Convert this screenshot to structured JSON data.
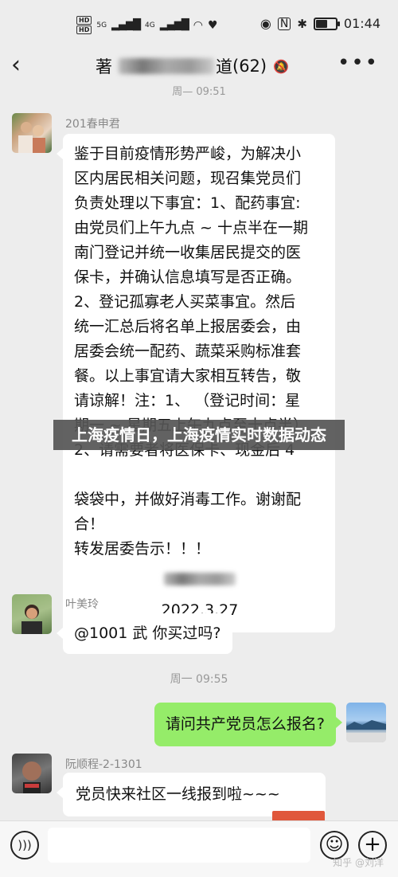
{
  "status_bar": {
    "hd1": "HD",
    "hd2": "HD",
    "signal1": "5G",
    "signal2": "4G",
    "time": "01:44"
  },
  "header": {
    "back_icon": "chevron-left-icon",
    "title_visible_suffix": "(62)",
    "title_prefix_char": "著",
    "title_partial_char": "道",
    "more_icon": "ellipsis-icon"
  },
  "time_header": "周— 09:51",
  "messages": [
    {
      "sender": "201春申君",
      "text": "鉴于目前疫情形势严峻，为解决小\n区内居民相关问题，现召集党员们\n负责处理以下事宜：1、配药事宜:\n由党员们上午九点 ~ 十点半在一期\n南门登记并统一收集居民提交的医\n保卡，并确认信息填写是否正确。\n2、登记孤寡老人买菜事宜。然后\n统一汇总后将名单上报居委会，由\n居委会统一配药、蔬菜采购标准套\n餐。以上事宜请大家相互转告，敬\n请谅解！注：1、 （登记时间：星\n期一 ~ 星期五上午九点至十点半）\n2、请需要者将医保卡、现金后 4\n\n袋袋中，并做好消毒工作。谢谢配\n合！\n转发居委告示！！！",
      "date": "2022.3.27",
      "avatar_icon": "person-photo-icon"
    },
    {
      "sender": "叶美玲",
      "text": "@1001 武  你买过吗?",
      "avatar_icon": "person-photo-icon"
    },
    {
      "sender": "阮顺程-2-1301",
      "text": "党员快来社区一线报到啦~~~",
      "avatar_icon": "person-photo-icon"
    }
  ],
  "time_separator": "周一 09:55",
  "my_message": {
    "text": "请问共产党员怎么报名?",
    "avatar_icon": "landscape-photo-icon"
  },
  "banner": "上海疫情日，上海疫情实时数据动态",
  "watermark": "知乎 @刘洋",
  "input": {
    "voice_icon": "voice-icon",
    "emoji_icon": "emoji-icon",
    "plus_icon": "plus-icon"
  },
  "colors": {
    "background": "#ededed",
    "my_bubble": "#95ec69",
    "other_bubble": "#ffffff"
  }
}
